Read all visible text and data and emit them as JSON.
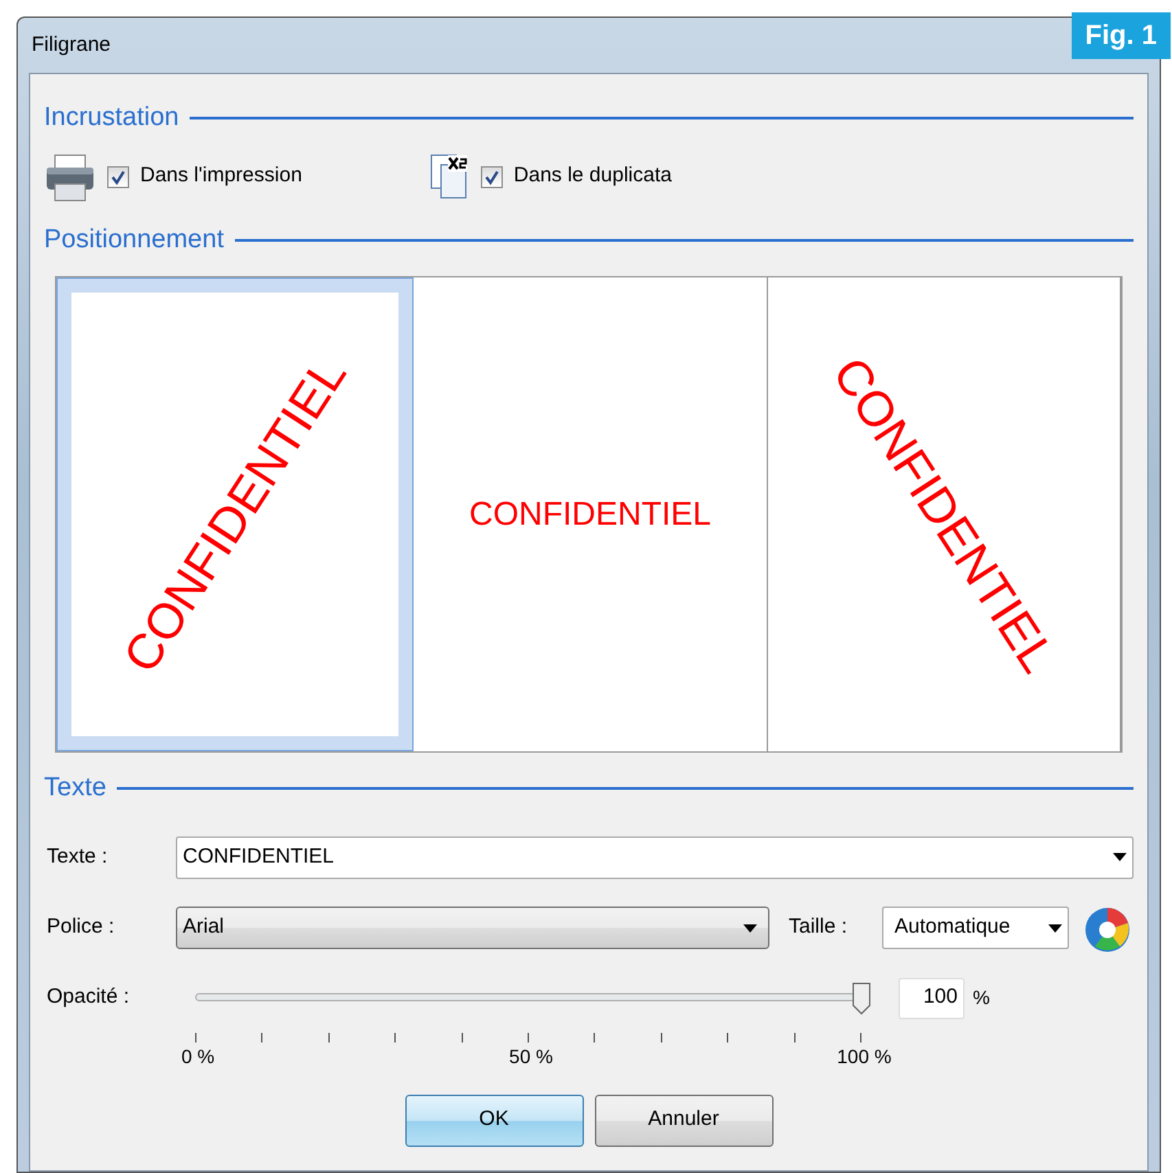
{
  "window": {
    "title": "Filigrane"
  },
  "figure_label": "Fig. 1",
  "incrustation": {
    "title": "Incrustation",
    "options": [
      {
        "kind": "print",
        "label": "Dans l'impression",
        "checked": true
      },
      {
        "kind": "duplicate",
        "label": "Dans le duplicata",
        "checked": true
      }
    ]
  },
  "positionnement": {
    "title": "Positionnement",
    "options": [
      {
        "kind": "diagonal-up",
        "text": "CONFIDENTIEL",
        "selected": true
      },
      {
        "kind": "horizontal",
        "text": "CONFIDENTIEL",
        "selected": false
      },
      {
        "kind": "diagonal-down",
        "text": "CONFIDENTIEL",
        "selected": false
      }
    ]
  },
  "texte": {
    "title": "Texte",
    "text_field": {
      "label": "Texte :",
      "value": "CONFIDENTIEL"
    },
    "font_field": {
      "label": "Police :",
      "value": "Arial"
    },
    "size_field": {
      "label": "Taille :",
      "value": "Automatique"
    },
    "opacity": {
      "label": "Opacité :",
      "level": 1.0,
      "value": "100",
      "unit": "%",
      "tick_labels": [
        "0 %",
        "50 %",
        "100 %"
      ]
    }
  },
  "buttons": [
    {
      "label": "OK",
      "default": true
    },
    {
      "label": "Annuler",
      "default": false
    }
  ]
}
